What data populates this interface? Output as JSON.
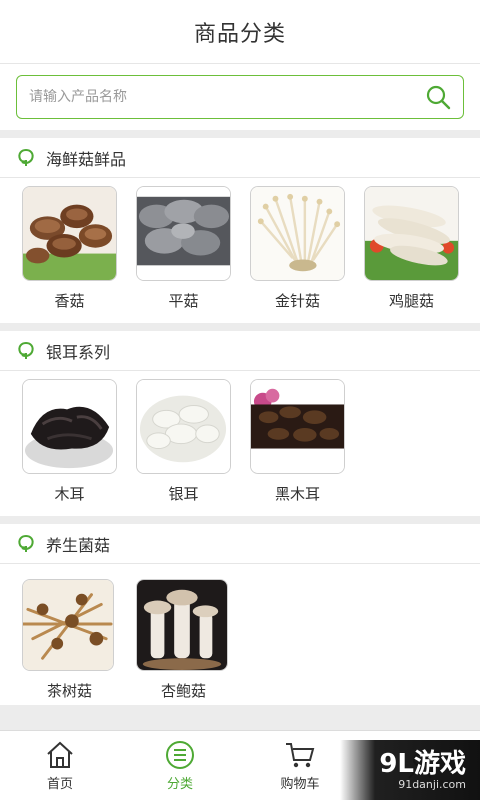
{
  "header": {
    "title": "商品分类"
  },
  "search": {
    "placeholder": "请输入产品名称"
  },
  "sections": [
    {
      "title": "海鲜菇鲜品",
      "items": [
        {
          "label": "香菇",
          "image": "shiitake"
        },
        {
          "label": "平菇",
          "image": "oyster-mushroom"
        },
        {
          "label": "金针菇",
          "image": "enoki"
        },
        {
          "label": "鸡腿菇",
          "image": "shaggy-mane"
        }
      ]
    },
    {
      "title": "银耳系列",
      "items": [
        {
          "label": "木耳",
          "image": "wood-ear"
        },
        {
          "label": "银耳",
          "image": "white-fungus"
        },
        {
          "label": "黑木耳",
          "image": "black-fungus"
        }
      ]
    },
    {
      "title": "养生菌菇",
      "items": [
        {
          "label": "茶树菇",
          "image": "tea-tree-mushroom"
        },
        {
          "label": "杏鲍菇",
          "image": "king-oyster"
        }
      ]
    }
  ],
  "tabbar": {
    "items": [
      {
        "label": "首页",
        "icon": "home-icon",
        "active": false
      },
      {
        "label": "分类",
        "icon": "category-list-icon",
        "active": true
      },
      {
        "label": "购物车",
        "icon": "cart-icon",
        "active": false
      },
      {
        "label": "",
        "icon": "user-icon",
        "active": false
      }
    ]
  },
  "watermark": {
    "main": "9L游戏",
    "sub": "91danji.com"
  },
  "colors": {
    "accent": "#4ea934",
    "border": "#6cbf3a",
    "divider": "#ececec"
  }
}
